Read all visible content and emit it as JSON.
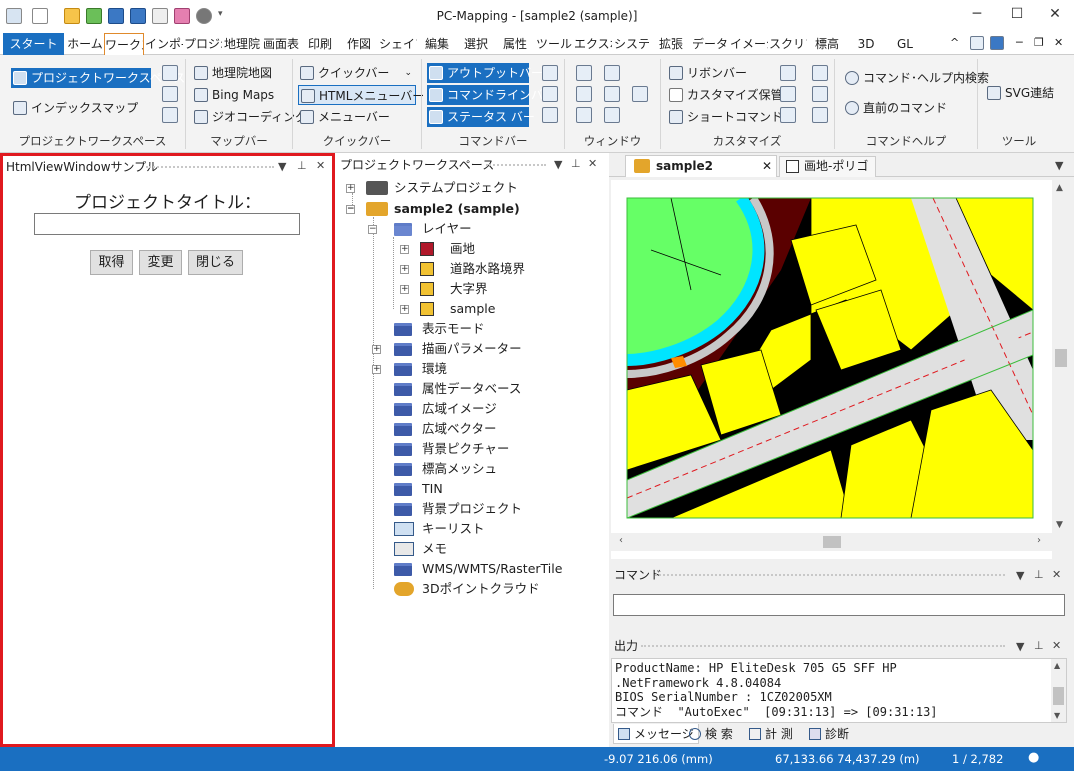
{
  "window": {
    "title": "PC-Mapping - [sample2 (sample)]"
  },
  "tabs": [
    "スタート",
    "ホーム",
    "ワークス",
    "インポ-",
    "プロジ:",
    "地理院",
    "画面表",
    "印刷",
    "作図",
    "シェイプ",
    "編集",
    "選択",
    "属性",
    "ツール",
    "エクスポ",
    "システ",
    "拡張",
    "データ",
    "イメージ",
    "スクリプ",
    "標高",
    "3D",
    "GL"
  ],
  "ribbon": {
    "groups": {
      "workspace": "プロジェクトワークスペース",
      "mapbar": "マップバー",
      "quickbar": "クイックバー",
      "commandbar": "コマンドバー",
      "window": "ウィンドウ",
      "customize": "カスタマイズ",
      "commandhelp": "コマンドヘルプ",
      "tool": "ツール"
    },
    "items": {
      "project_workspace": "プロジェクトワークスペース",
      "index_map": "インデックスマップ",
      "gsi_map": "地理院地図",
      "bing_maps": "Bing Maps",
      "geocoding": "ジオコーディング",
      "quick_bar": "クイックバー",
      "html_menu_bar": "HTMLメニューバー",
      "menu_bar": "メニューバー",
      "output_bar": "アウトプットバー",
      "command_line_bar": "コマンドラインバー",
      "status_bar": "ステータス バー",
      "ribbon_bar": "リボンバー",
      "save_customize": "カスタマイズ保管",
      "shortcut": "ショートコマンド",
      "help_search": "コマンド･ヘルプ内検索",
      "recent_command": "直前のコマンド",
      "svg_link": "SVG連結"
    }
  },
  "left_panel": {
    "title": "HtmlViewWindowサンプル",
    "heading": "プロジェクトタイトル：",
    "input_value": "",
    "buttons": {
      "get": "取得",
      "change": "変更",
      "close": "閉じる"
    }
  },
  "tree_panel": {
    "title": "プロジェクトワークスペース",
    "nodes": [
      {
        "label": "システムプロジェクト",
        "bold": false
      },
      {
        "label": "sample2 (sample)",
        "bold": true
      },
      {
        "label": "レイヤー"
      },
      {
        "label": "画地"
      },
      {
        "label": "道路水路境界"
      },
      {
        "label": "大字界"
      },
      {
        "label": "sample"
      },
      {
        "label": "表示モード"
      },
      {
        "label": "描画パラメーター"
      },
      {
        "label": "環境"
      },
      {
        "label": "属性データベース"
      },
      {
        "label": "広域イメージ"
      },
      {
        "label": "広域ベクター"
      },
      {
        "label": "背景ピクチャー"
      },
      {
        "label": "標高メッシュ"
      },
      {
        "label": "TIN"
      },
      {
        "label": "背景プロジェクト"
      },
      {
        "label": "キーリスト"
      },
      {
        "label": "メモ"
      },
      {
        "label": "WMS/WMTS/RasterTile"
      },
      {
        "label": "3Dポイントクラウド"
      }
    ]
  },
  "doc_tabs": [
    "sample2 (sample)",
    "画地-ポリゴン"
  ],
  "command_panel": {
    "title": "コマンド",
    "value": ""
  },
  "output_panel": {
    "title": "出力",
    "lines": [
      "ProductName: HP EliteDesk 705 G5 SFF HP",
      ".NetFramework 4.8.04084",
      "BIOS SerialNumber : 1CZ02005XM",
      "コマンド  \"AutoExec\"  [09:31:13] => [09:31:13]"
    ],
    "tabs": [
      "メッセージ",
      "検 索",
      "計 測",
      "診断"
    ]
  },
  "status": {
    "coords1": "-9.07 216.06 (mm)",
    "coords2": "67,133.66 74,437.29 (m)",
    "scale": "1 / 2,782"
  },
  "colors": {
    "accent": "#1a6fc1",
    "highlight_border": "#e0191f",
    "parcel": "#ffff00",
    "water": "#00e5ff",
    "park": "#66ff66",
    "dark_parcel": "#5a0000"
  }
}
